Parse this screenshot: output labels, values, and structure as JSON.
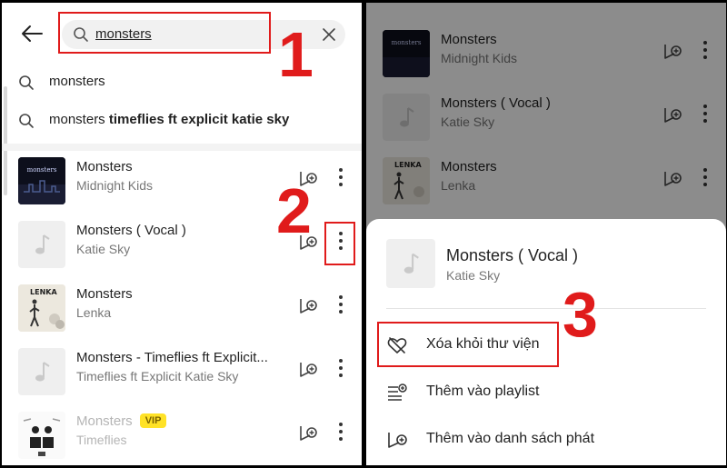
{
  "search": {
    "query": "monsters"
  },
  "suggestions": [
    {
      "plain": "monsters",
      "bold": ""
    },
    {
      "plain": "monsters ",
      "bold": "timeflies ft explicit katie sky"
    }
  ],
  "songs": [
    {
      "title": "Monsters",
      "artist": "Midnight Kids",
      "thumb": "album-art-midnight-kids"
    },
    {
      "title": "Monsters ( Vocal )",
      "artist": "Katie Sky",
      "thumb": "music-note-placeholder"
    },
    {
      "title": "Monsters",
      "artist": "Lenka",
      "thumb": "album-art-lenka"
    },
    {
      "title": "Monsters - Timeflies ft Explicit...",
      "artist": "Timeflies ft Explicit  Katie Sky",
      "thumb": "music-note-placeholder"
    },
    {
      "title": "Monsters",
      "artist": "Timeflies",
      "badge": "VIP",
      "thumb": "album-art-timeflies",
      "faded": true
    }
  ],
  "right_songs": [
    {
      "title": "Monsters",
      "artist": "Midnight Kids"
    },
    {
      "title": "Monsters ( Vocal )",
      "artist": "Katie Sky"
    },
    {
      "title": "Monsters",
      "artist": "Lenka"
    }
  ],
  "sheet": {
    "title": "Monsters ( Vocal )",
    "artist": "Katie Sky",
    "menu": [
      {
        "label": "Xóa khỏi thư viện",
        "icon": "heart-remove-icon"
      },
      {
        "label": "Thêm vào playlist",
        "icon": "playlist-add-icon"
      },
      {
        "label": "Thêm vào danh sách phát",
        "icon": "queue-add-icon"
      }
    ]
  },
  "step_markers": [
    "1",
    "2",
    "3"
  ],
  "colors": {
    "highlight": "#e01b1b",
    "vip": "#ffe227"
  }
}
